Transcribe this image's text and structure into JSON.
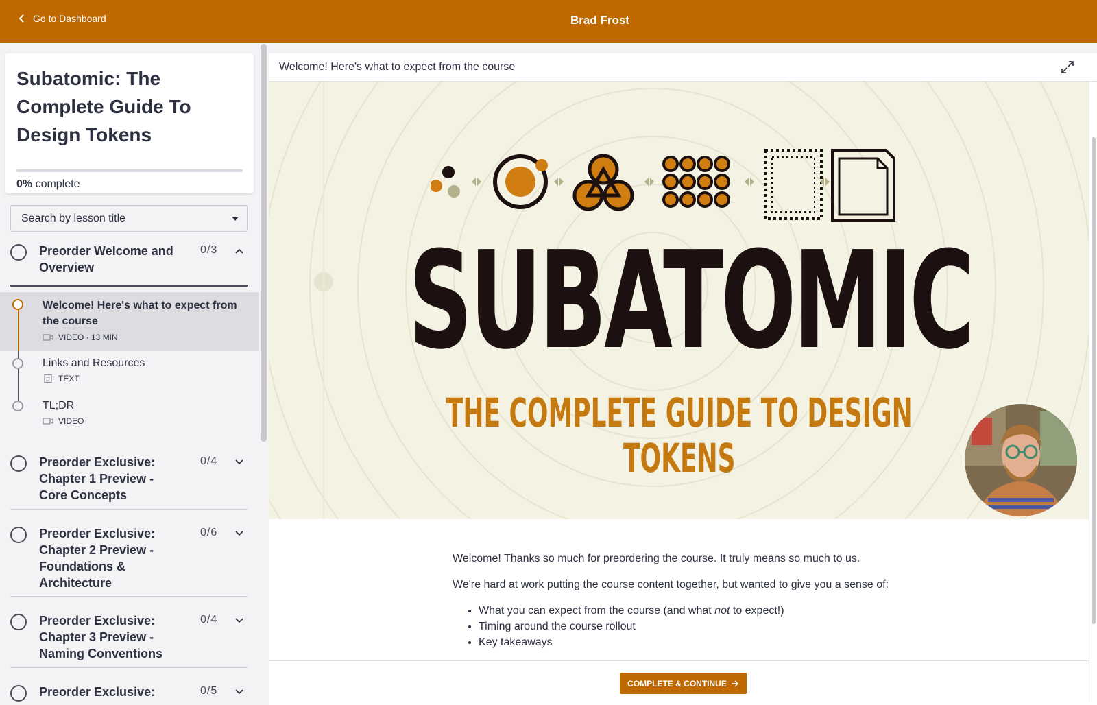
{
  "topbar": {
    "back_label": "Go to Dashboard",
    "title": "Brad Frost"
  },
  "course": {
    "title": "Subatomic: The Complete Guide To Design Tokens",
    "progress_percent": 0,
    "progress_value": "0%",
    "progress_suffix": " complete"
  },
  "search": {
    "placeholder": "Search by lesson title"
  },
  "chapters": [
    {
      "title": "Preorder Welcome and Overview",
      "count": "0/3",
      "expanded": true,
      "lessons": [
        {
          "title": "Welcome! Here's what to expect from the course",
          "type": "VIDEO · 13 MIN",
          "icon": "video-icon",
          "active": true
        },
        {
          "title": "Links and Resources",
          "type": "TEXT",
          "icon": "text-doc-icon",
          "active": false
        },
        {
          "title": "TL;DR",
          "type": "VIDEO",
          "icon": "video-icon",
          "active": false
        }
      ]
    },
    {
      "title": "Preorder Exclusive: Chapter 1 Preview - Core Concepts",
      "count": "0/4",
      "expanded": false
    },
    {
      "title": "Preorder Exclusive: Chapter 2 Preview - Foundations & Architecture",
      "count": "0/6",
      "expanded": false
    },
    {
      "title": "Preorder Exclusive: Chapter 3 Preview - Naming Conventions",
      "count": "0/4",
      "expanded": false
    },
    {
      "title": "Preorder Exclusive:",
      "count": "0/5",
      "expanded": false
    }
  ],
  "lesson_view": {
    "header_title": "Welcome! Here's what to expect from the course",
    "video": {
      "brand_title": "SUBATOMIC",
      "brand_subtitle": "THE COMPLETE GUIDE TO DESIGN TOKENS"
    },
    "body": {
      "p1": "Welcome! Thanks so much for preordering the course. It truly means so much to us.",
      "p2": "We're hard at work putting the course content together, but wanted to give you a sense of:",
      "bullets": {
        "b1_pre": "What you can expect from the course (and what ",
        "b1_em": "not",
        "b1_post": " to expect!)",
        "b2": "Timing around the course rollout",
        "b3": "Key takeaways"
      }
    },
    "cta_label": "COMPLETE & CONTINUE"
  },
  "colors": {
    "brand": "#c06800",
    "text": "#2d3142",
    "video_bg": "#f3f2e3",
    "subtitle_orange": "#c47a10"
  }
}
